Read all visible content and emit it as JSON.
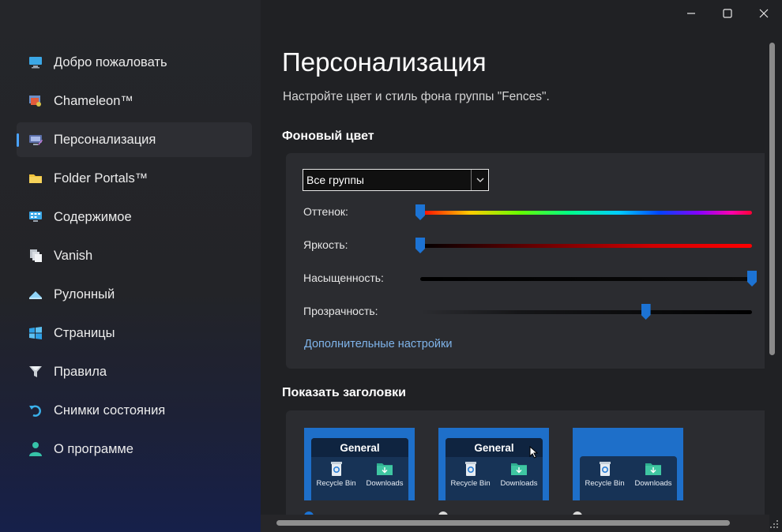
{
  "window": {
    "minimize_icon": "minimize-icon",
    "maximize_icon": "maximize-icon",
    "close_icon": "close-icon"
  },
  "sidebar": {
    "items": [
      {
        "label": "Добро пожаловать",
        "icon": "monitor-icon",
        "active": false
      },
      {
        "label": "Chameleon™",
        "icon": "chameleon-icon",
        "active": false
      },
      {
        "label": "Персонализация",
        "icon": "personalize-icon",
        "active": true
      },
      {
        "label": "Folder Portals™",
        "icon": "folder-icon",
        "active": false
      },
      {
        "label": "Содержимое",
        "icon": "desktop-grid-icon",
        "active": false
      },
      {
        "label": "Vanish",
        "icon": "pages-icon",
        "active": false
      },
      {
        "label": "Рулонный",
        "icon": "rollup-icon",
        "active": false
      },
      {
        "label": "Страницы",
        "icon": "windows-icon",
        "active": false
      },
      {
        "label": "Правила",
        "icon": "filter-icon",
        "active": false
      },
      {
        "label": "Снимки состояния",
        "icon": "undo-icon",
        "active": false
      },
      {
        "label": "О программе",
        "icon": "user-icon",
        "active": false
      }
    ]
  },
  "main": {
    "title": "Персонализация",
    "subtitle": "Настройте цвет и стиль фона группы \"Fences\".",
    "background_section": {
      "title": "Фоновый цвет",
      "select_value": "Все группы",
      "sliders": [
        {
          "label": "Оттенок:",
          "value": 0.0
        },
        {
          "label": "Яркость:",
          "value": 0.0
        },
        {
          "label": "Насыщенность:",
          "value": 1.0
        },
        {
          "label": "Прозрачность:",
          "value": 0.68
        }
      ],
      "more_link": "Дополнительные настройки"
    },
    "headers_section": {
      "title": "Показать заголовки",
      "previews": [
        {
          "header": "General",
          "items": [
            "Recycle Bin",
            "Downloads"
          ]
        },
        {
          "header": "General",
          "items": [
            "Recycle Bin",
            "Downloads"
          ]
        },
        {
          "header": "",
          "items": [
            "Recycle Bin",
            "Downloads"
          ]
        }
      ]
    }
  },
  "colors": {
    "accent": "#1c73d4",
    "link": "#7fb4ea",
    "preview_bg": "#1e6fc9"
  }
}
